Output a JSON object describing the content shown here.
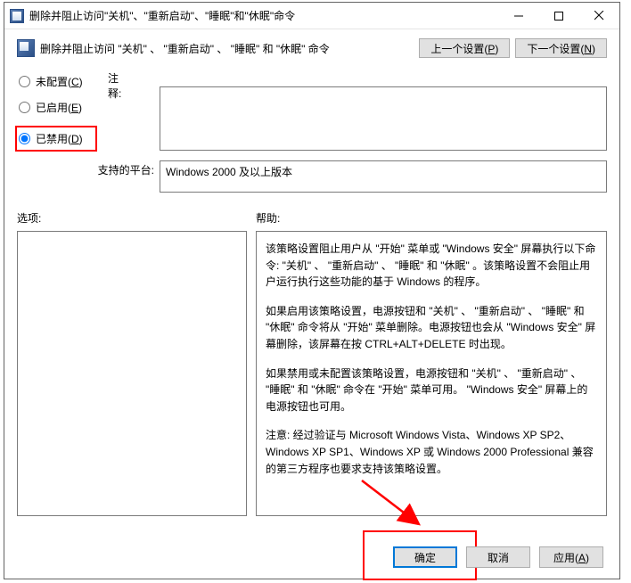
{
  "titlebar": {
    "title": "删除并阻止访问\"关机\"、\"重新启动\"、\"睡眠\"和\"休眠\"命令"
  },
  "header": {
    "title": "删除并阻止访问 \"关机\" 、 \"重新启动\" 、 \"睡眠\" 和 \"休眠\" 命令",
    "prev_btn": "上一个设置(P)",
    "next_btn": "下一个设置(N)"
  },
  "radios": {
    "not_configured": "未配置(C)",
    "enabled": "已启用(E)",
    "disabled": "已禁用(D)"
  },
  "labels": {
    "comment": "注释:",
    "platform": "支持的平台:",
    "options": "选项:",
    "help": "帮助:"
  },
  "fields": {
    "comment": "",
    "platform": "Windows 2000 及以上版本"
  },
  "help": {
    "p1": "该策略设置阻止用户从 \"开始\" 菜单或 \"Windows 安全\" 屏幕执行以下命令: \"关机\" 、 \"重新启动\" 、 \"睡眠\" 和 \"休眠\" 。该策略设置不会阻止用户运行执行这些功能的基于 Windows 的程序。",
    "p2": "如果启用该策略设置，电源按钮和 \"关机\" 、 \"重新启动\" 、 \"睡眠\" 和 \"休眠\" 命令将从 \"开始\" 菜单删除。电源按钮也会从 \"Windows 安全\" 屏幕删除，该屏幕在按 CTRL+ALT+DELETE 时出现。",
    "p3": "如果禁用或未配置该策略设置，电源按钮和 \"关机\" 、 \"重新启动\" 、 \"睡眠\" 和 \"休眠\" 命令在 \"开始\" 菜单可用。 \"Windows 安全\" 屏幕上的电源按钮也可用。",
    "p4": "注意: 经过验证与 Microsoft Windows Vista、Windows XP SP2、Windows XP SP1、Windows XP 或 Windows 2000 Professional 兼容的第三方程序也要求支持该策略设置。"
  },
  "footer": {
    "ok": "确定",
    "cancel": "取消",
    "apply": "应用(A)"
  }
}
